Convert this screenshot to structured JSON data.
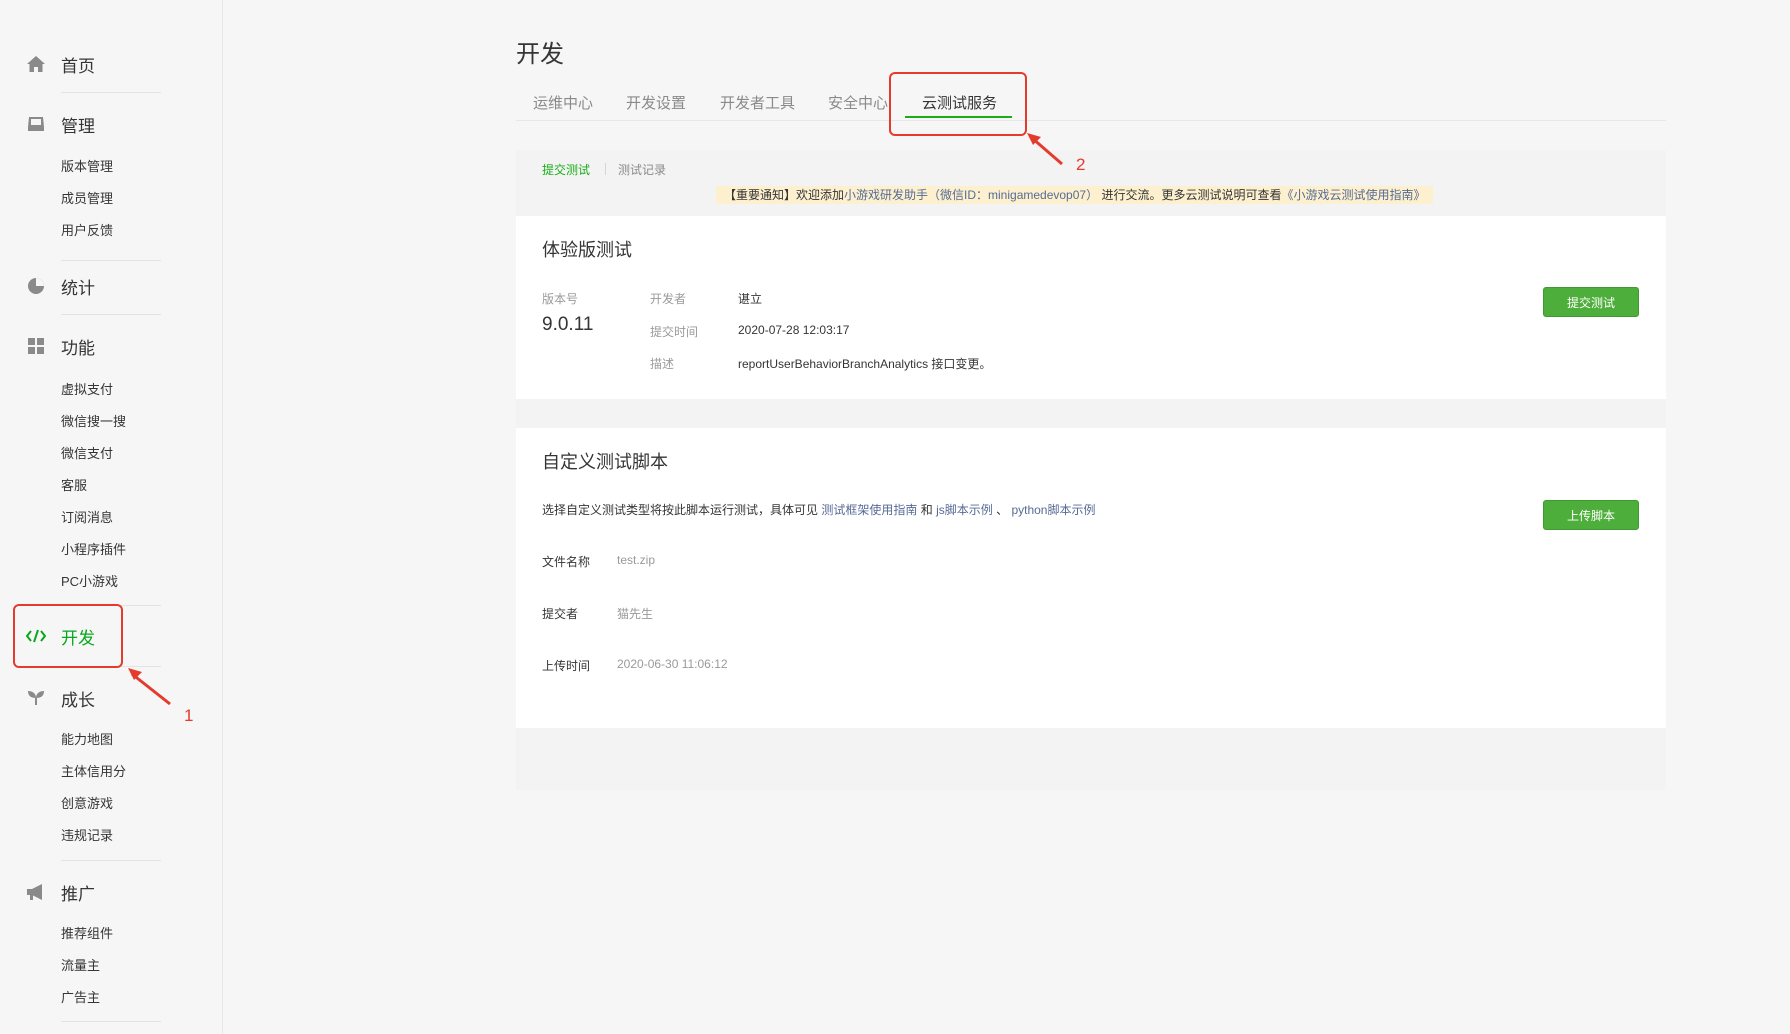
{
  "sidebar": {
    "home": {
      "label": "首页",
      "icon": "home-icon"
    },
    "manage": {
      "label": "管理",
      "icon": "inbox-icon",
      "items": [
        "版本管理",
        "成员管理",
        "用户反馈"
      ]
    },
    "stats": {
      "label": "统计",
      "icon": "pie-chart-icon"
    },
    "features": {
      "label": "功能",
      "icon": "grid-icon",
      "items": [
        "虚拟支付",
        "微信搜一搜",
        "微信支付",
        "客服",
        "订阅消息",
        "小程序插件",
        "PC小游戏"
      ]
    },
    "dev": {
      "label": "开发",
      "icon": "code-icon",
      "active": true
    },
    "growth": {
      "label": "成长",
      "icon": "sprout-icon",
      "items": [
        "能力地图",
        "主体信用分",
        "创意游戏",
        "违规记录"
      ]
    },
    "promo": {
      "label": "推广",
      "icon": "megaphone-icon",
      "items": [
        "推荐组件",
        "流量主",
        "广告主"
      ]
    }
  },
  "page": {
    "title": "开发",
    "tabs": [
      "运维中心",
      "开发设置",
      "开发者工具",
      "安全中心",
      "云测试服务"
    ],
    "active_tab": "云测试服务"
  },
  "subtabs": {
    "submit": "提交测试",
    "records": "测试记录"
  },
  "notice": {
    "prefix": "【重要通知】欢迎添加",
    "assistant": "小游戏研发助手（微信ID：minigamedevop07）",
    "middle": "进行交流。更多云测试说明可查看",
    "guide": "《小游戏云测试使用指南》"
  },
  "trial_test": {
    "title": "体验版测试",
    "version_label": "版本号",
    "version": "9.0.11",
    "developer_label": "开发者",
    "developer": "谌立",
    "submit_time_label": "提交时间",
    "submit_time": "2020-07-28 12:03:17",
    "desc_label": "描述",
    "desc": "reportUserBehaviorBranchAnalytics 接口变更。",
    "button": "提交测试"
  },
  "custom_script": {
    "title": "自定义测试脚本",
    "intro_prefix": "选择自定义测试类型将按此脚本运行测试，具体可见",
    "link_guide": "测试框架使用指南",
    "and": "和",
    "link_js": "js脚本示例",
    "sep": "、",
    "link_py": "python脚本示例",
    "file_label": "文件名称",
    "file": "test.zip",
    "submitter_label": "提交者",
    "submitter": "猫先生",
    "upload_time_label": "上传时间",
    "upload_time": "2020-06-30 11:06:12",
    "button": "上传脚本"
  },
  "annotations": {
    "one": "1",
    "two": "2",
    "color": "#e53b2c"
  }
}
